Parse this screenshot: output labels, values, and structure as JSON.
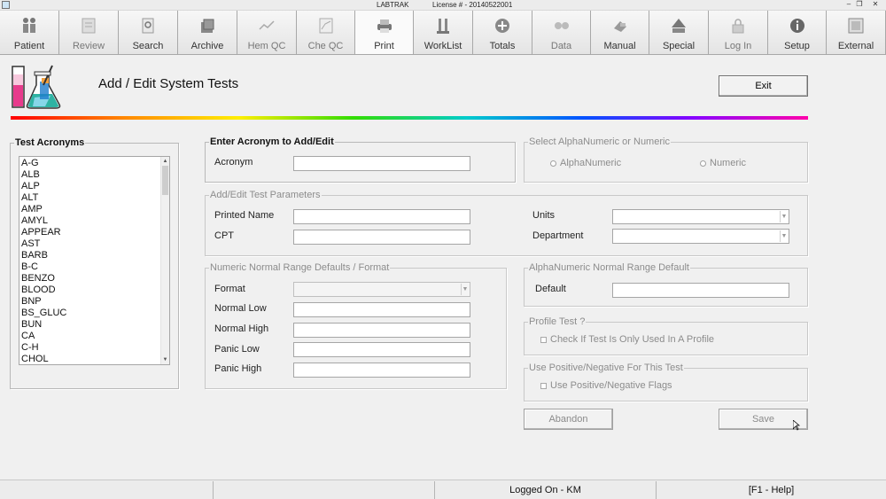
{
  "window": {
    "title": "LABTRAK",
    "license": "License # - 20140522001",
    "restore_glyph": "❐",
    "close_glyph": "✕"
  },
  "toolbar": [
    {
      "label": "Patient",
      "icon": "people-icon"
    },
    {
      "label": "Review",
      "icon": "review-icon"
    },
    {
      "label": "Search",
      "icon": "search-icon"
    },
    {
      "label": "Archive",
      "icon": "archive-icon"
    },
    {
      "label": "Hem QC",
      "icon": "hem-qc-icon"
    },
    {
      "label": "Che QC",
      "icon": "che-qc-icon"
    },
    {
      "label": "Print",
      "icon": "print-icon"
    },
    {
      "label": "WorkList",
      "icon": "worklist-icon"
    },
    {
      "label": "Totals",
      "icon": "totals-icon"
    },
    {
      "label": "Data",
      "icon": "data-icon"
    },
    {
      "label": "Manual",
      "icon": "manual-icon"
    },
    {
      "label": "Special",
      "icon": "special-icon"
    },
    {
      "label": "Log In",
      "icon": "lock-icon"
    },
    {
      "label": "Setup",
      "icon": "info-icon"
    },
    {
      "label": "External",
      "icon": "external-icon"
    }
  ],
  "page": {
    "title": "Add / Edit System Tests",
    "exit_label": "Exit"
  },
  "test_acronyms": {
    "legend": "Test Acronyms",
    "items": [
      "A-G",
      "ALB",
      "ALP",
      "ALT",
      "AMP",
      "AMYL",
      "APPEAR",
      "AST",
      "BARB",
      "B-C",
      "BENZO",
      "BLOOD",
      "BNP",
      "BS_GLUC",
      "BUN",
      "CA",
      "C-H",
      "CHOL"
    ]
  },
  "enter_acronym": {
    "legend": "Enter Acronym to Add/Edit",
    "acronym_label": "Acronym",
    "acronym_value": ""
  },
  "select_type": {
    "legend": "Select AlphaNumeric or Numeric",
    "alphanumeric_label": "AlphaNumeric",
    "numeric_label": "Numeric"
  },
  "test_params": {
    "legend": "Add/Edit Test Parameters",
    "printed_name_label": "Printed Name",
    "cpt_label": "CPT",
    "units_label": "Units",
    "department_label": "Department"
  },
  "numeric_range": {
    "legend": "Numeric Normal Range Defaults / Format",
    "format_label": "Format",
    "normal_low_label": "Normal Low",
    "normal_high_label": "Normal High",
    "panic_low_label": "Panic Low",
    "panic_high_label": "Panic High"
  },
  "alpha_range": {
    "legend": "AlphaNumeric Normal Range Default",
    "default_label": "Default"
  },
  "profile_test": {
    "legend": "Profile Test ?",
    "check_label": "Check If Test Is Only Used In A Profile"
  },
  "pos_neg": {
    "legend": "Use Positive/Negative For This Test",
    "check_label": "Use Positive/Negative Flags"
  },
  "actions": {
    "abandon_label": "Abandon",
    "save_label": "Save"
  },
  "status": {
    "cell1": "",
    "cell2": "",
    "logged_on": "Logged On - KM",
    "help": "[F1 - Help]"
  },
  "colors": {
    "accent_red": "#e02020",
    "rainbow_start": "#ff0000",
    "rainbow_end": "#ff00aa"
  }
}
